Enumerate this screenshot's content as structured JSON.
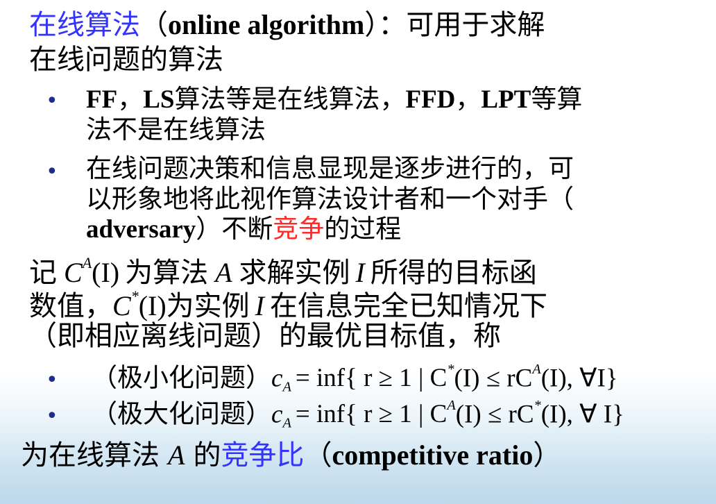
{
  "heading": {
    "term": "在线算法",
    "paren_open": "（",
    "term_en": "online algorithm",
    "paren_close": "）",
    "colon_rest": "：可用于求解",
    "line2": "在线问题的算法"
  },
  "bullet1": {
    "marker": "•",
    "a1": "FF",
    "a2": "，",
    "a3": "LS",
    "a4": "算法等是在线算法，",
    "a5": "FFD",
    "a6": "，",
    "a7": "LPT",
    "a8": "等算",
    "line2": "法不是在线算法"
  },
  "bullet2": {
    "marker": "•",
    "line1": "在线问题决策和信息显现是逐步进行的，可",
    "line2": "以形象地将此视作算法设计者和一个对手（",
    "line3_en": "adversary",
    "line3_mid": "）不断",
    "line3_red": "竞争",
    "line3_end": "的过程"
  },
  "para": {
    "l1_a": "记",
    "l1_C": "C",
    "l1_A_sup": "A",
    "l1_I": "(I)",
    "l1_b": "为算法",
    "l1_A": "A",
    "l1_c": "求解实例",
    "l1_I2": "I",
    "l1_d": "所得的目标函",
    "l2_a": "数值，",
    "l2_C": "C",
    "l2_star": "*",
    "l2_I": "(I)",
    "l2_b": "为实例",
    "l2_I2": "I",
    "l2_c": "在信息完全已知情况下",
    "l3": "（即相应离线问题）的最优目标值，称"
  },
  "formula_min": {
    "marker": "•",
    "label": "（极小化问题）",
    "cA": "c",
    "cA_sub": "A",
    "eq": "= inf{ r ≥ 1 | C",
    "sup1": "*",
    "mid": "(I) ≤ rC",
    "sup2": "A",
    "end": "(I), ∀I}"
  },
  "formula_max": {
    "marker": "•",
    "label": "（极大化问题）",
    "cA": "c",
    "cA_sub": "A",
    "eq": "= inf{ r ≥ 1 | C",
    "sup1": "A",
    "mid": "(I) ≤ rC",
    "sup2": "*",
    "end": "(I), ∀ I}"
  },
  "closing": {
    "a": "为在线算法",
    "A": "A",
    "b": "的",
    "blue": "竞争比",
    "paren_open": "（",
    "en": "competitive ratio",
    "paren_close": "）"
  },
  "colors": {
    "highlight_blue": "#3333ff",
    "highlight_red": "#ff2a2a",
    "bullet": "#1e2d8c"
  }
}
